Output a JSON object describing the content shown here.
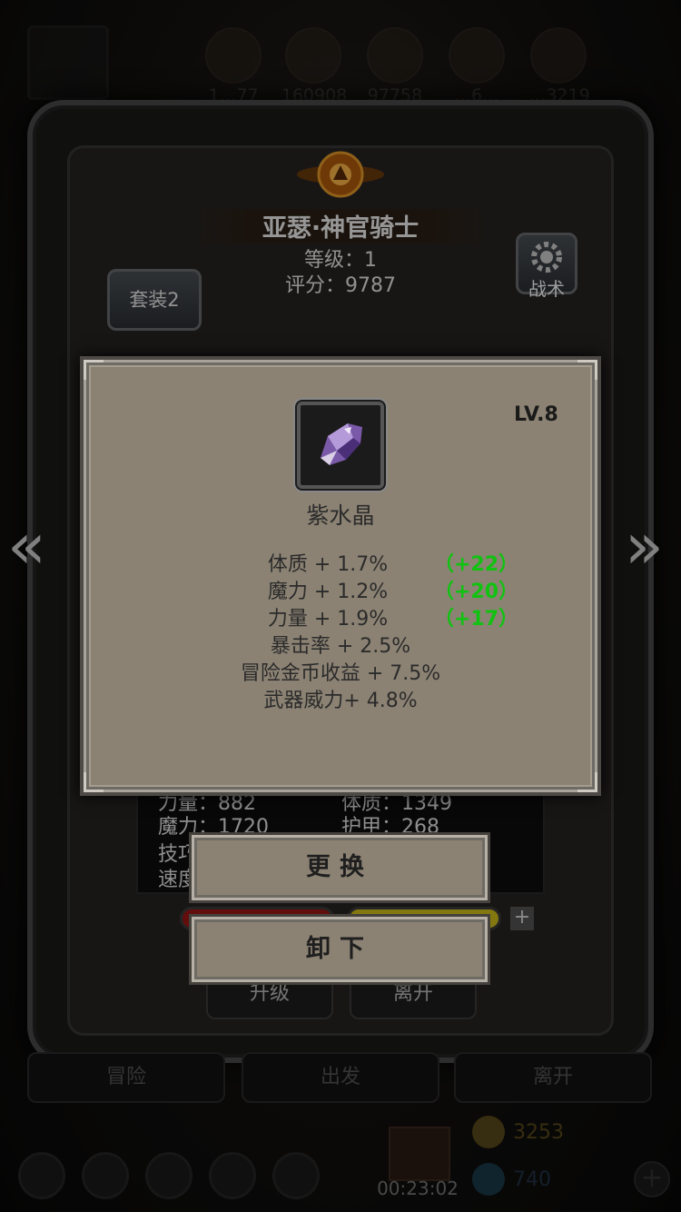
{
  "top_resources": [
    "1…77",
    "160908",
    "97758",
    "…6…",
    "…3219"
  ],
  "hero": {
    "name": "亚瑟·神官骑士",
    "level": "等级：1",
    "score": "评分：9787"
  },
  "set_button": "套装2",
  "tactics_button": "战术",
  "nav_arrows": {
    "left": "«",
    "right": "»"
  },
  "background_stats": [
    "力量：882",
    "体质：1349",
    "魔力：1720",
    "护甲：268",
    "技巧",
    "速度"
  ],
  "background_buttons": {
    "upgrade": "升级",
    "leave": "离开"
  },
  "bottom_nav": [
    "冒险",
    "出发",
    "离开"
  ],
  "gift_timer": "00:23:02",
  "currency": {
    "coins": "3253",
    "gems": "740"
  },
  "item_popup": {
    "level": "LV.8",
    "name": "紫水晶",
    "icon": "purple-crystal-icon",
    "attributes": [
      {
        "text": "体质 + 1.7%",
        "bonus": "（+22）"
      },
      {
        "text": "魔力 + 1.2%",
        "bonus": "（+20）"
      },
      {
        "text": "力量 + 1.9%",
        "bonus": "（+17）"
      },
      {
        "text": "暴击率 + 2.5%",
        "bonus": ""
      },
      {
        "text": "冒险金币收益 + 7.5%",
        "bonus": ""
      },
      {
        "text": "武器威力+ 4.8%",
        "bonus": ""
      }
    ]
  },
  "actions": {
    "replace": "更换",
    "unequip": "卸下"
  },
  "colors": {
    "bonus_green": "#11c211",
    "popup_bg": "#8b8273"
  }
}
